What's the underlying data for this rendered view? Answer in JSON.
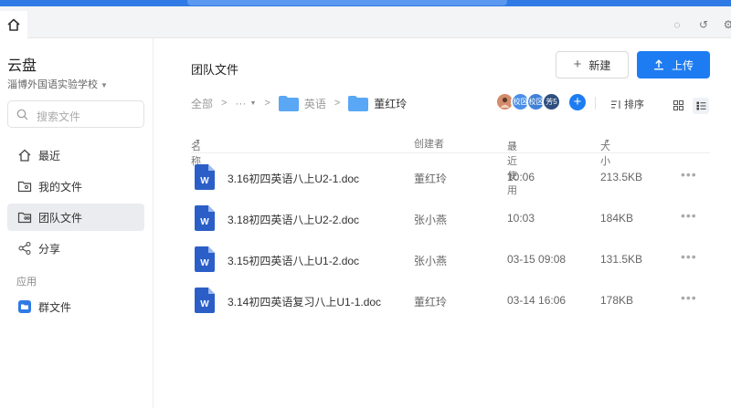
{
  "sidebar": {
    "title": "云盘",
    "org": "淄博外国语实验学校",
    "search_placeholder": "搜索文件",
    "nav": [
      {
        "label": "最近",
        "icon": "clock-home-icon"
      },
      {
        "label": "我的文件",
        "icon": "folder-user-icon"
      },
      {
        "label": "团队文件",
        "icon": "folder-team-icon",
        "active": true
      },
      {
        "label": "分享",
        "icon": "share-icon"
      }
    ],
    "section_apps": "应用",
    "apps": [
      {
        "label": "群文件",
        "icon": "group-files-icon"
      }
    ]
  },
  "main": {
    "title": "团队文件",
    "new_label": "新建",
    "upload_label": "上传",
    "breadcrumb": {
      "root": "全部",
      "ellipsis": "···",
      "folder1": "英语",
      "current": "董红玲"
    },
    "avatars": [
      {
        "kind": "photo",
        "color": "#d48b6a",
        "text": ""
      },
      {
        "kind": "text",
        "color": "#4a8fe8",
        "text": "校区"
      },
      {
        "kind": "text",
        "color": "#3f82d8",
        "text": "校区"
      },
      {
        "kind": "text",
        "color": "#2f4f7f",
        "text": "芳5"
      }
    ],
    "sort_label": "排序",
    "columns": {
      "name": "名称",
      "creator": "创建者",
      "time": "最近使用",
      "size": "大小"
    },
    "files": [
      {
        "name": "3.16初四英语八上U2-1.doc",
        "creator": "董红玲",
        "time": "10:06",
        "size": "213.5KB"
      },
      {
        "name": "3.18初四英语八上U2-2.doc",
        "creator": "张小燕",
        "time": "10:03",
        "size": "184KB"
      },
      {
        "name": "3.15初四英语八上U1-2.doc",
        "creator": "张小燕",
        "time": "03-15 09:08",
        "size": "131.5KB"
      },
      {
        "name": "3.14初四英语复习八上U1-1.doc",
        "creator": "董红玲",
        "time": "03-14 16:06",
        "size": "178KB"
      }
    ]
  },
  "colors": {
    "accent": "#1d7cf2",
    "word_icon": "#2b5fc7",
    "folder": "#5aa7f5"
  }
}
